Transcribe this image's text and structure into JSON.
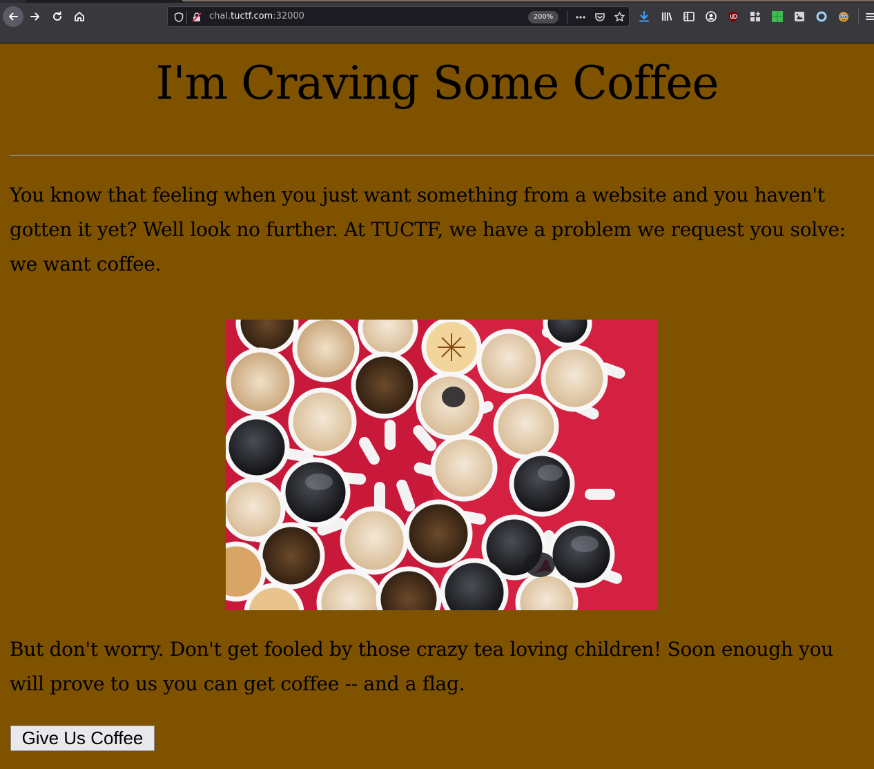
{
  "browser": {
    "url_host_prefix": "chal.",
    "url_host": "tuctf.com",
    "url_port": ":32000",
    "zoom_level": "200%"
  },
  "page": {
    "title": "I'm Craving Some Coffee",
    "paragraph_1": "You know that feeling when you just want something from a website and you haven't gotten it yet? Well look no further. At TUCTF, we have a problem we request you solve: we want coffee.",
    "paragraph_2": "But don't worry. Don't get fooled by those crazy tea loving children! Soon enough you will prove to us you can get coffee -- and a flag.",
    "button_label": "Give Us Coffee",
    "background_color": "#7f5200"
  }
}
